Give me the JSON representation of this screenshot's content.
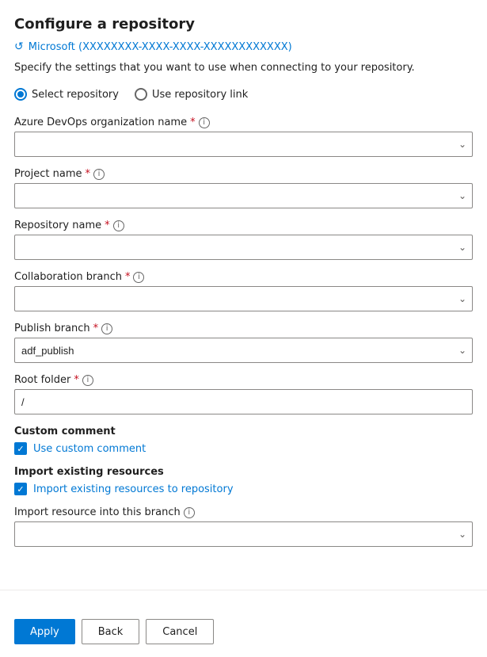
{
  "title": "Configure a repository",
  "account": {
    "icon": "↺",
    "text": "Microsoft (XXXXXXXX-XXXX-XXXX-XXXXXXXXXXXX)"
  },
  "description": "Specify the settings that you want to use when connecting to your repository.",
  "radio_group": {
    "options": [
      {
        "id": "select-repo",
        "label": "Select repository",
        "selected": true
      },
      {
        "id": "use-link",
        "label": "Use repository link",
        "selected": false
      }
    ]
  },
  "fields": [
    {
      "id": "azure-devops-org",
      "label": "Azure DevOps organization name",
      "required": true,
      "info": true,
      "type": "dropdown",
      "value": "",
      "placeholder": ""
    },
    {
      "id": "project-name",
      "label": "Project name",
      "required": true,
      "info": true,
      "type": "dropdown",
      "value": "",
      "placeholder": ""
    },
    {
      "id": "repository-name",
      "label": "Repository name",
      "required": true,
      "info": true,
      "type": "dropdown",
      "value": "",
      "placeholder": ""
    },
    {
      "id": "collaboration-branch",
      "label": "Collaboration branch",
      "required": true,
      "info": true,
      "type": "dropdown",
      "value": "",
      "placeholder": ""
    },
    {
      "id": "publish-branch",
      "label": "Publish branch",
      "required": true,
      "info": true,
      "type": "dropdown",
      "value": "adf_publish",
      "placeholder": ""
    },
    {
      "id": "root-folder",
      "label": "Root folder",
      "required": true,
      "info": true,
      "type": "text",
      "value": "/"
    }
  ],
  "custom_comment": {
    "section_label": "Custom comment",
    "checkbox_label": "Use custom comment",
    "checked": true
  },
  "import_existing": {
    "section_label": "Import existing resources",
    "checkbox_label": "Import existing resources to repository",
    "checked": true
  },
  "import_resource_branch": {
    "label": "Import resource into this branch",
    "info": true,
    "type": "dropdown",
    "value": "",
    "placeholder": ""
  },
  "footer": {
    "apply_label": "Apply",
    "back_label": "Back",
    "cancel_label": "Cancel"
  }
}
